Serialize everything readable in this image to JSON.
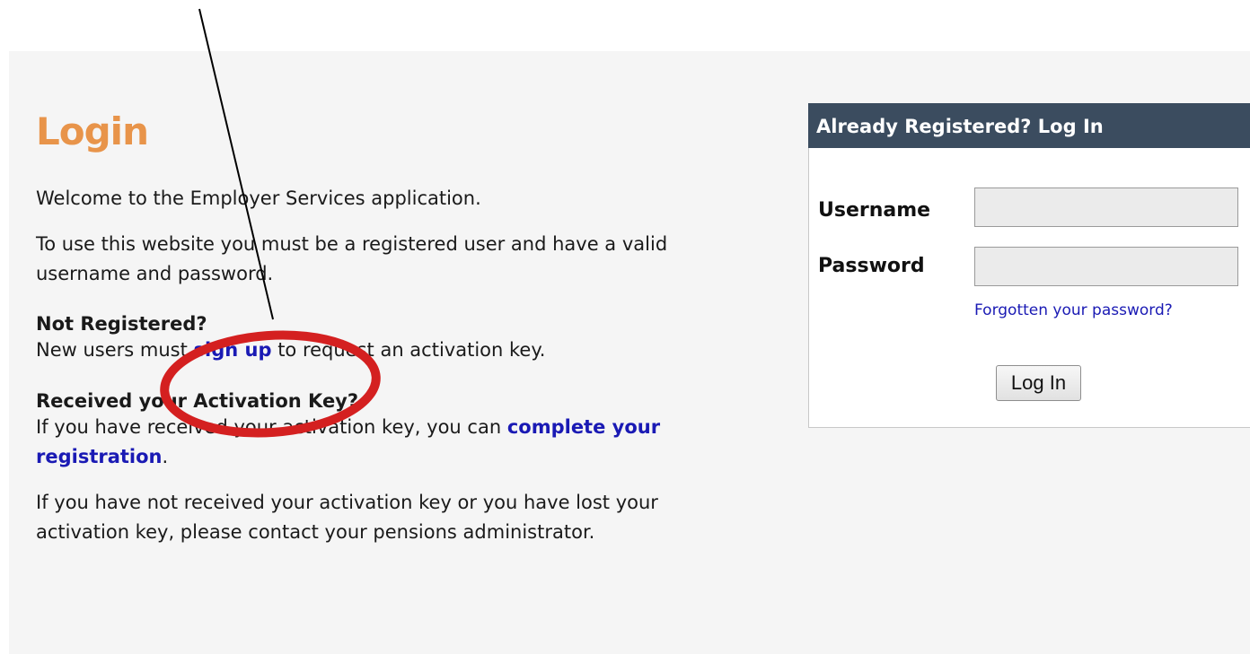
{
  "page": {
    "title": "Login",
    "welcome": "Welcome to the Employer Services application.",
    "must_register": "To use this website you must be a registered user and have a valid username and password.",
    "not_registered": {
      "heading": "Not Registered?",
      "text_before": "New users must ",
      "link": "sign up",
      "text_after": " to request an activation key."
    },
    "received_key": {
      "heading": "Received your Activation Key?",
      "text_before": "If you have received your activation key, you can ",
      "link": "complete your registration",
      "text_after": "."
    },
    "lost_key": "If you have not received your activation key or you have lost your activation key, please contact your pensions administrator."
  },
  "login_box": {
    "header": "Already Registered? Log In",
    "username_label": "Username",
    "password_label": "Password",
    "username_value": "",
    "password_value": "",
    "forgot_link": "Forgotten your password?",
    "login_button": "Log In"
  },
  "annotation": {
    "color": "#d42020",
    "line_color": "#000000"
  },
  "colors": {
    "title": "#e8944a",
    "link": "#1a1ab4",
    "header_bg": "#3b4c5f",
    "panel_bg": "#f5f5f5"
  }
}
